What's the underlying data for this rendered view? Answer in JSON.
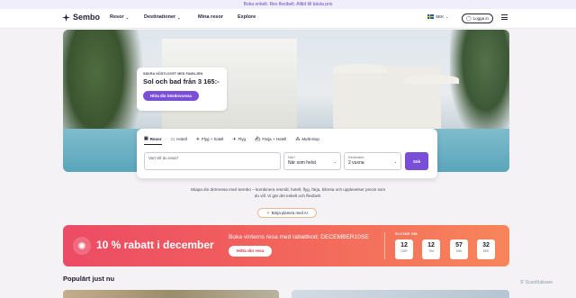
{
  "announcement": "Boka enkelt. Res flexibelt. Alltid till bästa pris",
  "nav": {
    "brand": "Sembo",
    "links": [
      {
        "label": "Resor",
        "dropdown": true
      },
      {
        "label": "Destinationer",
        "dropdown": true
      },
      {
        "label": "Mina resor",
        "dropdown": false
      },
      {
        "label": "Explore",
        "dropdown": false
      }
    ],
    "currency": "SEK",
    "login": "Logga in"
  },
  "hero_promo": {
    "kicker": "SÄKRA HÖSTLOVET MED FAMILJEN",
    "title": "Sol och bad från 3 165:-",
    "button": "Hitta din höstlovsresa"
  },
  "search": {
    "tabs": [
      {
        "label": "Resor",
        "icon": "suitcase-icon",
        "active": true
      },
      {
        "label": "Hotell",
        "icon": "bed-icon",
        "active": false
      },
      {
        "label": "Flyg + hotell",
        "icon": "plane-hotel-icon",
        "active": false
      },
      {
        "label": "Flyg",
        "icon": "plane-icon",
        "active": false
      },
      {
        "label": "Färja + Hotell",
        "icon": "ferry-icon",
        "active": false
      },
      {
        "label": "Multi-stop",
        "icon": "multi-stop-icon",
        "active": false
      }
    ],
    "destination_placeholder": "Vart vill du resa?",
    "when_label": "När?",
    "when_value": "När som helst",
    "travelers_label": "Resenärer",
    "travelers_value": "2 vuxna",
    "submit": "Sök"
  },
  "intro": {
    "text": "Skapa din drömresa med Sembo – kombinera resmål, hotell, flyg, färja, bilresa och upplevelser precis som du vill. Vi gör det enkelt och flexibelt.",
    "ai_button": "Börja planera med AI"
  },
  "deal": {
    "title": "10 % rabatt i december",
    "subtitle": "Boka vinterns resa med rabattkod: DECEMBER10SE",
    "button": "Hitta din resa",
    "ends_label": "SLUTAR OM:",
    "countdown": [
      {
        "value": "12",
        "unit": "DGR"
      },
      {
        "value": "12",
        "unit": "TIM"
      },
      {
        "value": "57",
        "unit": "MIN"
      },
      {
        "value": "32",
        "unit": "SEK"
      }
    ]
  },
  "popular_title": "Populärt just nu",
  "watermark": "ScanMalware",
  "colors": {
    "accent": "#7a4fd8",
    "deal_start": "#ec4b65",
    "deal_end": "#f7855a"
  }
}
